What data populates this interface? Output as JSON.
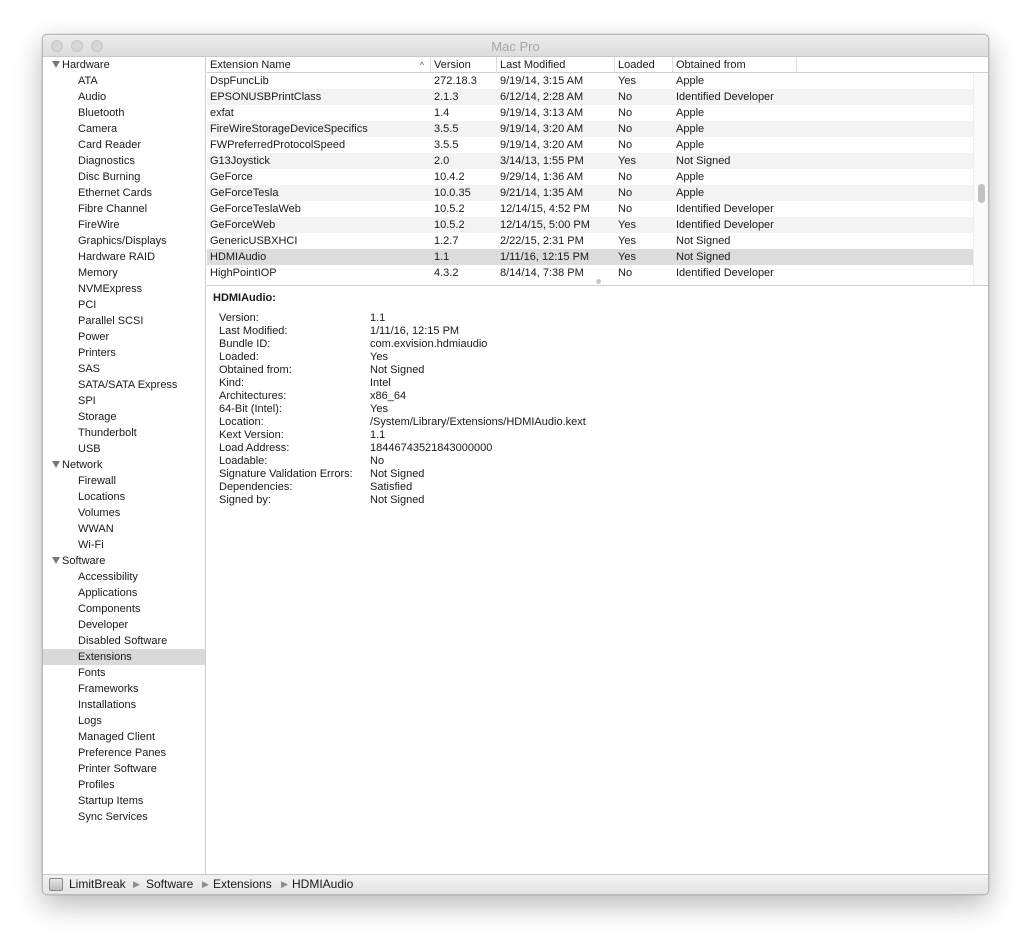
{
  "window": {
    "title": "Mac Pro"
  },
  "sidebar": {
    "groups": [
      {
        "label": "Hardware",
        "items": [
          "ATA",
          "Audio",
          "Bluetooth",
          "Camera",
          "Card Reader",
          "Diagnostics",
          "Disc Burning",
          "Ethernet Cards",
          "Fibre Channel",
          "FireWire",
          "Graphics/Displays",
          "Hardware RAID",
          "Memory",
          "NVMExpress",
          "PCI",
          "Parallel SCSI",
          "Power",
          "Printers",
          "SAS",
          "SATA/SATA Express",
          "SPI",
          "Storage",
          "Thunderbolt",
          "USB"
        ]
      },
      {
        "label": "Network",
        "items": [
          "Firewall",
          "Locations",
          "Volumes",
          "WWAN",
          "Wi-Fi"
        ]
      },
      {
        "label": "Software",
        "items": [
          "Accessibility",
          "Applications",
          "Components",
          "Developer",
          "Disabled Software",
          "Extensions",
          "Fonts",
          "Frameworks",
          "Installations",
          "Logs",
          "Managed Client",
          "Preference Panes",
          "Printer Software",
          "Profiles",
          "Startup Items",
          "Sync Services"
        ]
      }
    ],
    "selected": "Extensions"
  },
  "table": {
    "columns": [
      "Extension Name",
      "Version",
      "Last Modified",
      "Loaded",
      "Obtained from"
    ],
    "sort_indicator": "^",
    "rows": [
      [
        "DspFuncLib",
        "272.18.3",
        "9/19/14, 3:15 AM",
        "Yes",
        "Apple"
      ],
      [
        "EPSONUSBPrintClass",
        "2.1.3",
        "6/12/14, 2:28 AM",
        "No",
        "Identified Developer"
      ],
      [
        "exfat",
        "1.4",
        "9/19/14, 3:13 AM",
        "No",
        "Apple"
      ],
      [
        "FireWireStorageDeviceSpecifics",
        "3.5.5",
        "9/19/14, 3:20 AM",
        "No",
        "Apple"
      ],
      [
        "FWPreferredProtocolSpeed",
        "3.5.5",
        "9/19/14, 3:20 AM",
        "No",
        "Apple"
      ],
      [
        "G13Joystick",
        "2.0",
        "3/14/13, 1:55 PM",
        "Yes",
        "Not Signed"
      ],
      [
        "GeForce",
        "10.4.2",
        "9/29/14, 1:36 AM",
        "No",
        "Apple"
      ],
      [
        "GeForceTesla",
        "10.0.35",
        "9/21/14, 1:35 AM",
        "No",
        "Apple"
      ],
      [
        "GeForceTeslaWeb",
        "10.5.2",
        "12/14/15, 4:52 PM",
        "No",
        "Identified Developer"
      ],
      [
        "GeForceWeb",
        "10.5.2",
        "12/14/15, 5:00 PM",
        "Yes",
        "Identified Developer"
      ],
      [
        "GenericUSBXHCI",
        "1.2.7",
        "2/22/15, 2:31 PM",
        "Yes",
        "Not Signed"
      ],
      [
        "HDMIAudio",
        "1.1",
        "1/11/16, 12:15 PM",
        "Yes",
        "Not Signed"
      ],
      [
        "HighPointIOP",
        "4.3.2",
        "8/14/14, 7:38 PM",
        "No",
        "Identified Developer"
      ]
    ],
    "selected_row": 11
  },
  "detail": {
    "title": "HDMIAudio:",
    "fields": [
      [
        "Version:",
        "1.1"
      ],
      [
        "Last Modified:",
        "1/11/16, 12:15 PM"
      ],
      [
        "Bundle ID:",
        "com.exvision.hdmiaudio"
      ],
      [
        "Loaded:",
        "Yes"
      ],
      [
        "Obtained from:",
        "Not Signed"
      ],
      [
        "Kind:",
        "Intel"
      ],
      [
        "Architectures:",
        "x86_64"
      ],
      [
        "64-Bit (Intel):",
        "Yes"
      ],
      [
        "Location:",
        "/System/Library/Extensions/HDMIAudio.kext"
      ],
      [
        "Kext Version:",
        "1.1"
      ],
      [
        "Load Address:",
        "18446743521843000000"
      ],
      [
        "Loadable:",
        "No"
      ],
      [
        "Signature Validation Errors:",
        "Not Signed"
      ],
      [
        "Dependencies:",
        "Satisfied"
      ],
      [
        "Signed by:",
        "Not Signed"
      ]
    ]
  },
  "pathbar": {
    "icon": "computer-icon",
    "segments": [
      "LimitBreak",
      "Software",
      "Extensions",
      "HDMIAudio"
    ],
    "separator": "▶"
  }
}
